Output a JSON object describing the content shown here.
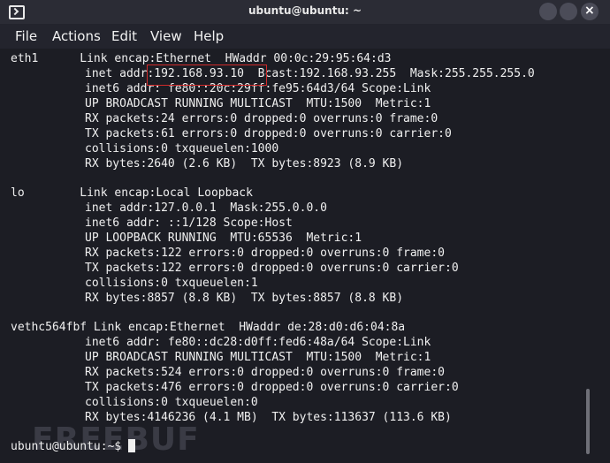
{
  "window": {
    "title": "ubuntu@ubuntu: ~"
  },
  "menu": [
    "File",
    "Actions",
    "Edit",
    "View",
    "Help"
  ],
  "terminal": {
    "lines": [
      "eth1      Link encap:Ethernet  HWaddr 00:0c:29:95:64:d3",
      "inet addr:192.168.93.10  Bcast:192.168.93.255  Mask:255.255.255.0",
      "inet6 addr: fe80::20c:29ff:fe95:64d3/64 Scope:Link",
      "UP BROADCAST RUNNING MULTICAST  MTU:1500  Metric:1",
      "RX packets:24 errors:0 dropped:0 overruns:0 frame:0",
      "TX packets:61 errors:0 dropped:0 overruns:0 carrier:0",
      "collisions:0 txqueuelen:1000",
      "RX bytes:2640 (2.6 KB)  TX bytes:8923 (8.9 KB)",
      "lo        Link encap:Local Loopback",
      "inet addr:127.0.0.1  Mask:255.0.0.0",
      "inet6 addr: ::1/128 Scope:Host",
      "UP LOOPBACK RUNNING  MTU:65536  Metric:1",
      "RX packets:122 errors:0 dropped:0 overruns:0 frame:0",
      "TX packets:122 errors:0 dropped:0 overruns:0 carrier:0",
      "collisions:0 txqueuelen:1",
      "RX bytes:8857 (8.8 KB)  TX bytes:8857 (8.8 KB)",
      "vethc564fbf Link encap:Ethernet  HWaddr de:28:d0:d6:04:8a",
      "inet6 addr: fe80::dc28:d0ff:fed6:48a/64 Scope:Link",
      "UP BROADCAST RUNNING MULTICAST  MTU:1500  Metric:1",
      "RX packets:524 errors:0 dropped:0 overruns:0 frame:0",
      "TX packets:476 errors:0 dropped:0 overruns:0 carrier:0",
      "collisions:0 txqueuelen:0",
      "RX bytes:4146236 (4.1 MB)  TX bytes:113637 (113.6 KB)"
    ],
    "prompt": "ubuntu@ubuntu:~$ "
  },
  "watermark": "FREEBUF",
  "colors": {
    "text": "#f0f0f0",
    "background": "#1c1d24",
    "highlight_box": "#d12a2a"
  },
  "icons": {
    "app": "terminal-icon"
  }
}
